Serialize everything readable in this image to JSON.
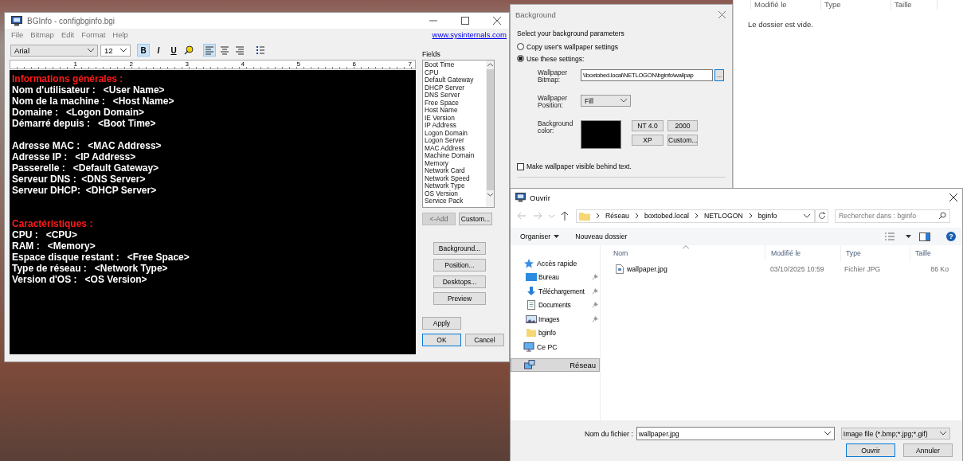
{
  "explorer_behind": {
    "columns": [
      "Modifié le",
      "Type",
      "Taille"
    ],
    "empty_text": "Le dossier est vide."
  },
  "bginfo": {
    "title": "BGInfo - configbginfo.bgi",
    "menu": [
      "File",
      "Bitmap",
      "Edit",
      "Format",
      "Help"
    ],
    "link": "www.sysinternals.com",
    "font": "Arial",
    "size": "12",
    "toolbar": [
      {
        "kind": "bold",
        "label": "B",
        "selected": true
      },
      {
        "kind": "italic",
        "label": "I",
        "selected": false
      },
      {
        "kind": "underline",
        "label": "U",
        "selected": false
      },
      {
        "kind": "color",
        "selected": false
      },
      {
        "kind": "align-left",
        "selected": true
      },
      {
        "kind": "align-center",
        "selected": false
      },
      {
        "kind": "align-right",
        "selected": false
      },
      {
        "kind": "bullets",
        "selected": false
      }
    ],
    "ruler": [
      "1",
      "2",
      "3",
      "4",
      "5",
      "6",
      "7"
    ],
    "lines": [
      {
        "kind": "heading",
        "text": "Informations générales :"
      },
      {
        "kind": "field",
        "text": "Nom d'utilisateur :   <User Name>"
      },
      {
        "kind": "field",
        "text": "Nom de la machine :   <Host Name>"
      },
      {
        "kind": "field",
        "text": "Domaine :   <Logon Domain>"
      },
      {
        "kind": "field",
        "text": "Démarré depuis :   <Boot Time>"
      },
      {
        "kind": "blank"
      },
      {
        "kind": "field",
        "text": "Adresse MAC :   <MAC Address>"
      },
      {
        "kind": "field",
        "text": "Adresse IP :   <IP Address>"
      },
      {
        "kind": "field",
        "text": "Passerelle :   <Default Gateway>"
      },
      {
        "kind": "field",
        "text": "Serveur DNS :  <DNS Server>"
      },
      {
        "kind": "field",
        "text": "Serveur DHCP:  <DHCP Server>"
      },
      {
        "kind": "blank"
      },
      {
        "kind": "blank"
      },
      {
        "kind": "heading",
        "text": "Caractéristiques :"
      },
      {
        "kind": "field",
        "text": "CPU :   <CPU>"
      },
      {
        "kind": "field",
        "text": "RAM :   <Memory>"
      },
      {
        "kind": "field",
        "text": "Espace disque restant :   <Free Space>"
      },
      {
        "kind": "field",
        "text": "Type de réseau :   <Network Type>"
      },
      {
        "kind": "field",
        "text": "Version d'OS :   <OS Version>"
      }
    ],
    "fields_label": "Fields",
    "fields": [
      "Boot Time",
      "CPU",
      "Default Gateway",
      "DHCP Server",
      "DNS Server",
      "Free Space",
      "Host Name",
      "IE Version",
      "IP Address",
      "Logon Domain",
      "Logon Server",
      "MAC Address",
      "Machine Domain",
      "Memory",
      "Network Card",
      "Network Speed",
      "Network Type",
      "OS Version",
      "Service Pack"
    ],
    "add_button": {
      "label": "<-Add",
      "disabled": true
    },
    "custom_button": "Custom...",
    "side_buttons": [
      "Background...",
      "Position...",
      "Desktops...",
      "Preview"
    ],
    "apply": "Apply",
    "ok": "OK",
    "cancel": "Cancel"
  },
  "background_dialog": {
    "title": "Background",
    "prompt": "Select your background parameters",
    "options": [
      {
        "label": "Copy user's wallpaper settings",
        "selected": false
      },
      {
        "label": "Use these settings:",
        "selected": true
      }
    ],
    "bitmap_label": "Wallpaper Bitmap:",
    "bitmap_value": "\\\\boxtobed.local\\NETLOGON\\bginfo\\wallpap",
    "browse": "...",
    "position_label": "Wallpaper Position:",
    "position_value": "Fill",
    "color_label": "Background color:",
    "presets": [
      "NT 4.0",
      "2000",
      "XP",
      "Custom..."
    ],
    "checkbox": {
      "label": "Make wallpaper visible behind text.",
      "checked": false
    }
  },
  "open_dialog": {
    "title": "Ouvrir",
    "breadcrumb": [
      "Réseau",
      "boxtobed.local",
      "NETLOGON",
      "bginfo"
    ],
    "search_placeholder": "Rechercher dans : bginfo",
    "organize": "Organiser",
    "new_folder": "Nouveau dossier",
    "help": "?",
    "nav": [
      {
        "label": "Accès rapide",
        "kind": "star",
        "selected": false,
        "children": [
          {
            "label": "Bureau",
            "kind": "desktop",
            "pinned": true,
            "selected": false
          },
          {
            "label": "Téléchargement",
            "kind": "download",
            "pinned": true,
            "selected": false
          },
          {
            "label": "Documents",
            "kind": "documents",
            "pinned": true,
            "selected": false
          },
          {
            "label": "Images",
            "kind": "images",
            "pinned": true,
            "selected": false
          },
          {
            "label": "bginfo",
            "kind": "folder",
            "pinned": false,
            "selected": false
          }
        ]
      },
      {
        "label": "Ce PC",
        "kind": "computer",
        "selected": false
      },
      {
        "label": "Réseau",
        "kind": "network",
        "selected": true
      }
    ],
    "columns": [
      "Nom",
      "Modifié le",
      "Type",
      "Taille"
    ],
    "files": [
      {
        "name": "wallpaper.jpg",
        "modified": "03/10/2025 10:59",
        "type": "Fichier JPG",
        "size": "86 Ko"
      }
    ],
    "filename_label": "Nom du fichier :",
    "filename": "wallpaper.jpg",
    "filter": "Image file (*.bmp;*.jpg;*.gif)",
    "open": "Ouvrir",
    "cancel": "Annuler"
  }
}
